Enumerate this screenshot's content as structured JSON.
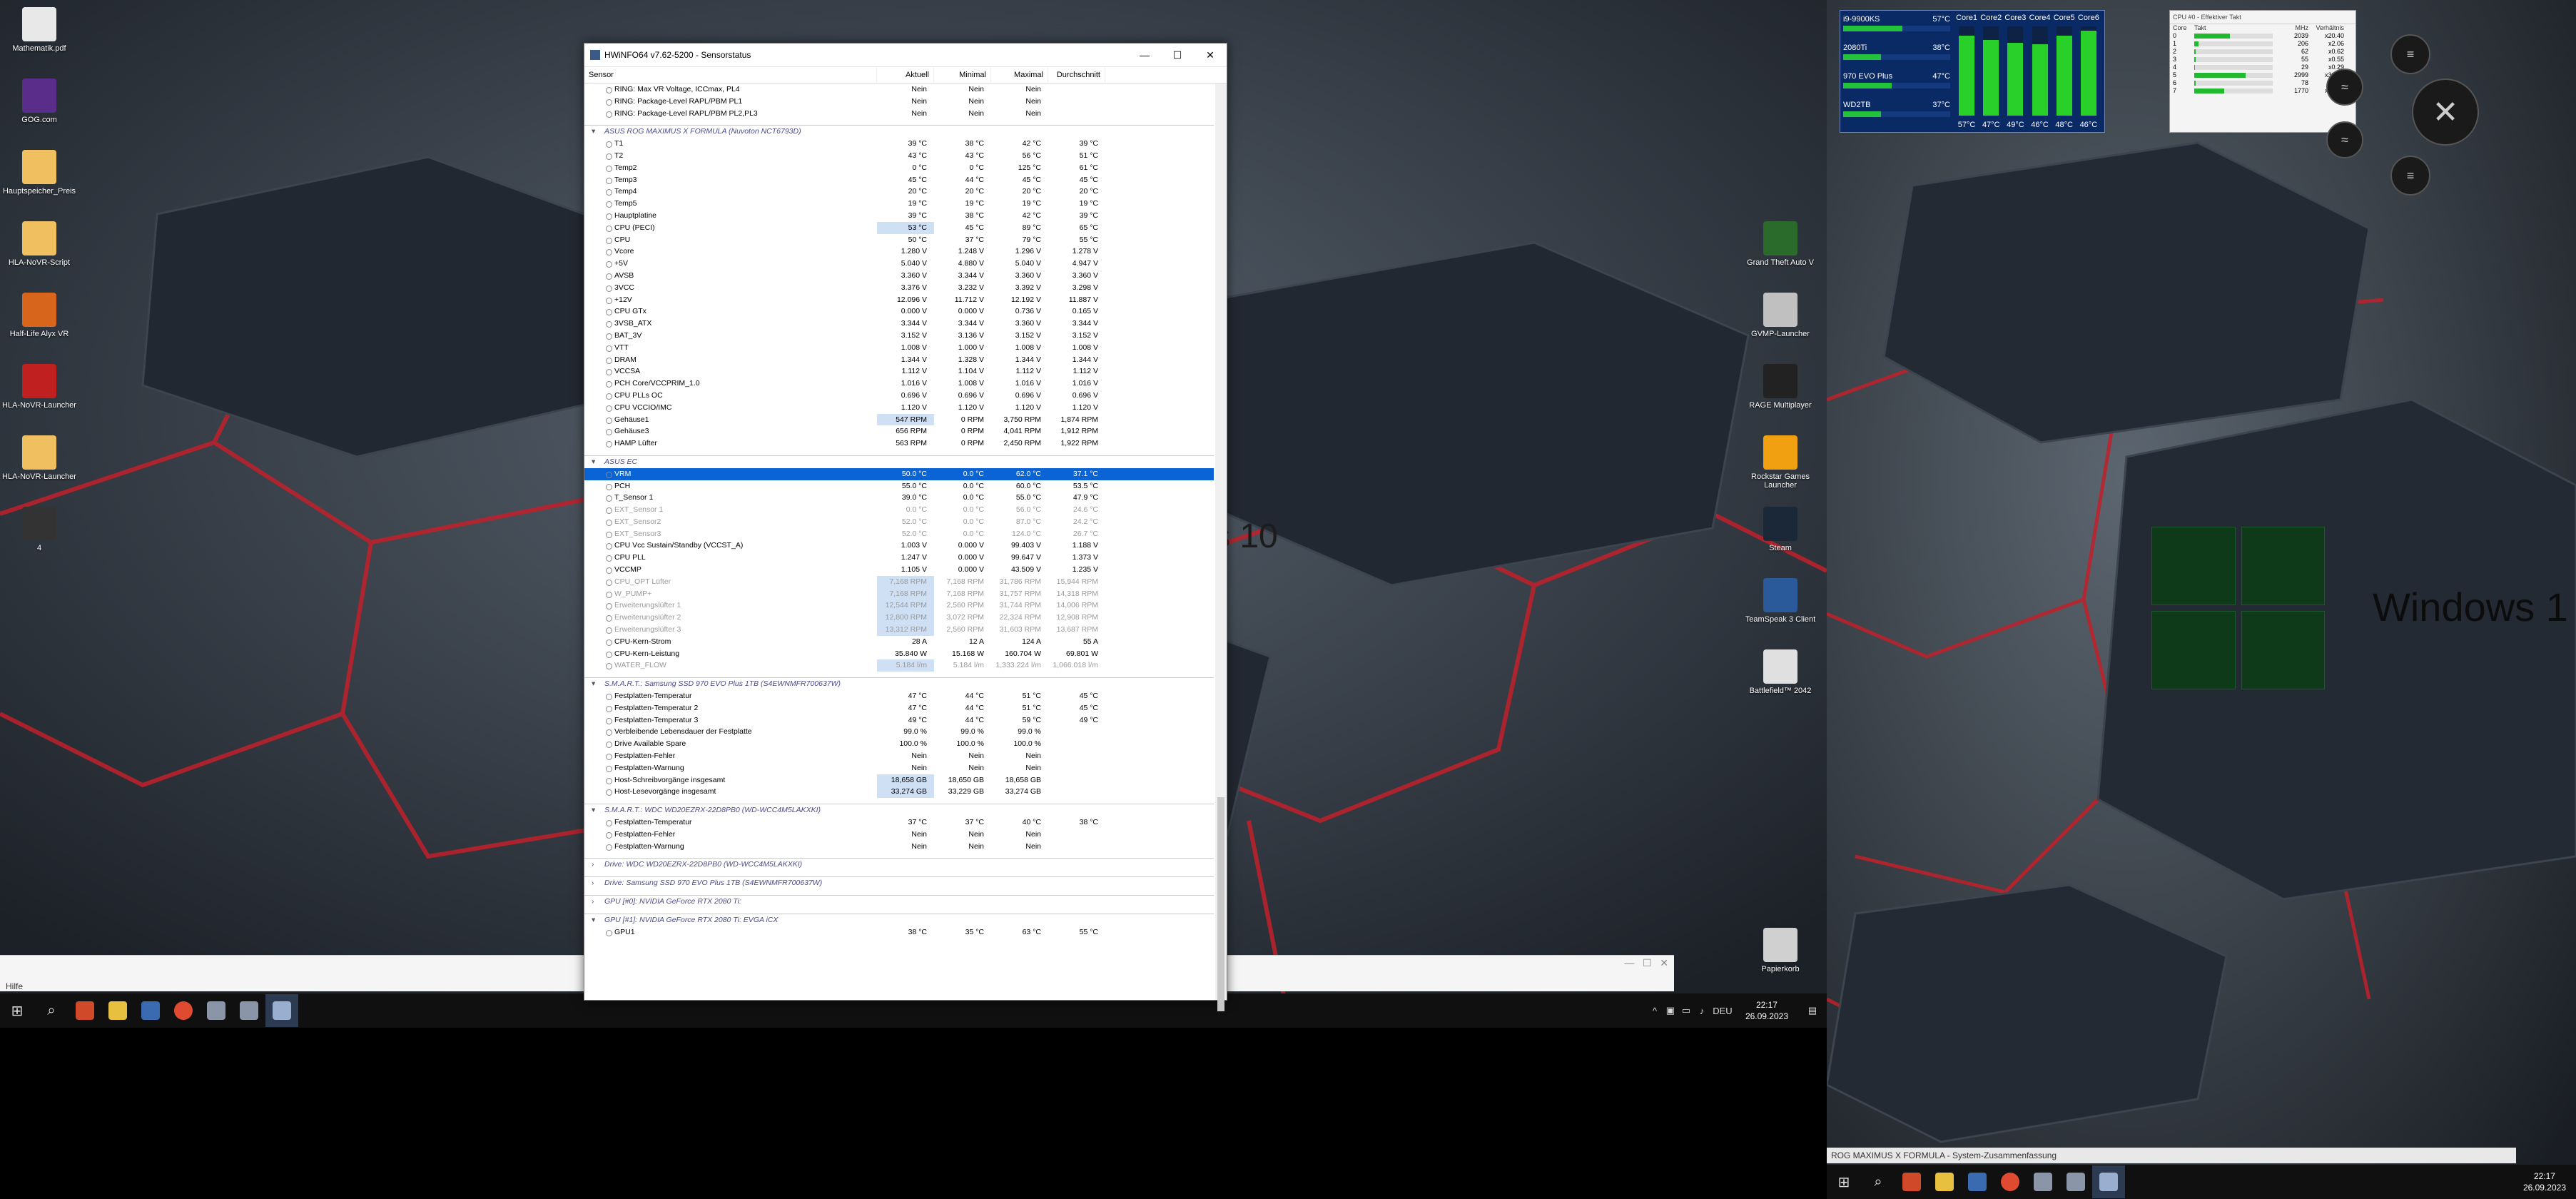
{
  "left_desktop": {
    "icons": [
      {
        "label": "Mathematik.pdf",
        "color": "#e8e8e8"
      },
      {
        "label": "GOG.com",
        "color": "#5b2d8a"
      },
      {
        "label": "Hauptspeicher_Preis",
        "color": "#f0c060"
      },
      {
        "label": "HLA-NoVR-Script",
        "color": "#f0c060"
      },
      {
        "label": "Half-Life Alyx VR",
        "color": "#d8651c"
      },
      {
        "label": "HLA-NoVR-Launcher",
        "color": "#c02020"
      },
      {
        "label": "HLA-NoVR-Launcher",
        "color": "#f0c060"
      },
      {
        "label": "4",
        "color": "#333"
      }
    ],
    "right_icons": [
      {
        "label": "Grand Theft Auto V",
        "color": "#2a6a2a"
      },
      {
        "label": "GVMP-Launcher",
        "color": "#c0c0c0"
      },
      {
        "label": "RAGE Multiplayer",
        "color": "#222"
      },
      {
        "label": "Rockstar Games Launcher",
        "color": "#f0a010"
      },
      {
        "label": "Steam",
        "color": "#1b2838"
      },
      {
        "label": "TeamSpeak 3 Client",
        "color": "#2a5a9a"
      },
      {
        "label": "Battlefield™ 2042",
        "color": "#e0e0e0"
      },
      {
        "label": "Papierkorb",
        "color": "#d0d0d0"
      }
    ],
    "wallpaper_text": "s 10"
  },
  "behind_window": {
    "menu": "Hilfe"
  },
  "hwinfo": {
    "title": "HWiNFO64 v7.62-5200 - Sensorstatus",
    "columns": [
      "Sensor",
      "Aktuell",
      "Minimal",
      "Maximal",
      "Durchschnitt"
    ],
    "rows": [
      {
        "t": "r",
        "n": "RING: Max VR Voltage, ICCmax, PL4",
        "a": "Nein",
        "mi": "Nein",
        "ma": "Nein",
        "d": ""
      },
      {
        "t": "r",
        "n": "RING: Package-Level RAPL/PBM PL1",
        "a": "Nein",
        "mi": "Nein",
        "ma": "Nein",
        "d": ""
      },
      {
        "t": "r",
        "n": "RING: Package-Level RAPL/PBM PL2,PL3",
        "a": "Nein",
        "mi": "Nein",
        "ma": "Nein",
        "d": ""
      },
      {
        "t": "s"
      },
      {
        "t": "g",
        "n": "ASUS ROG MAXIMUS X FORMULA (Nuvoton NCT6793D)"
      },
      {
        "t": "r",
        "n": "T1",
        "a": "39 °C",
        "mi": "38 °C",
        "ma": "42 °C",
        "d": "39 °C"
      },
      {
        "t": "r",
        "n": "T2",
        "a": "43 °C",
        "mi": "43 °C",
        "ma": "56 °C",
        "d": "51 °C"
      },
      {
        "t": "r",
        "n": "Temp2",
        "a": "0 °C",
        "mi": "0 °C",
        "ma": "125 °C",
        "d": "61 °C"
      },
      {
        "t": "r",
        "n": "Temp3",
        "a": "45 °C",
        "mi": "44 °C",
        "ma": "45 °C",
        "d": "45 °C"
      },
      {
        "t": "r",
        "n": "Temp4",
        "a": "20 °C",
        "mi": "20 °C",
        "ma": "20 °C",
        "d": "20 °C"
      },
      {
        "t": "r",
        "n": "Temp5",
        "a": "19 °C",
        "mi": "19 °C",
        "ma": "19 °C",
        "d": "19 °C"
      },
      {
        "t": "r",
        "n": "Hauptplatine",
        "a": "39 °C",
        "mi": "38 °C",
        "ma": "42 °C",
        "d": "39 °C"
      },
      {
        "t": "r",
        "h": 1,
        "n": "CPU (PECI)",
        "a": "53 °C",
        "mi": "45 °C",
        "ma": "89 °C",
        "d": "65 °C"
      },
      {
        "t": "r",
        "n": "CPU",
        "a": "50 °C",
        "mi": "37 °C",
        "ma": "79 °C",
        "d": "55 °C"
      },
      {
        "t": "r",
        "n": "Vcore",
        "a": "1.280 V",
        "mi": "1.248 V",
        "ma": "1.296 V",
        "d": "1.278 V"
      },
      {
        "t": "r",
        "n": "+5V",
        "a": "5.040 V",
        "mi": "4.880 V",
        "ma": "5.040 V",
        "d": "4.947 V"
      },
      {
        "t": "r",
        "n": "AVSB",
        "a": "3.360 V",
        "mi": "3.344 V",
        "ma": "3.360 V",
        "d": "3.360 V"
      },
      {
        "t": "r",
        "n": "3VCC",
        "a": "3.376 V",
        "mi": "3.232 V",
        "ma": "3.392 V",
        "d": "3.298 V"
      },
      {
        "t": "r",
        "n": "+12V",
        "a": "12.096 V",
        "mi": "11.712 V",
        "ma": "12.192 V",
        "d": "11.887 V"
      },
      {
        "t": "r",
        "n": "CPU GTx",
        "a": "0.000 V",
        "mi": "0.000 V",
        "ma": "0.736 V",
        "d": "0.165 V"
      },
      {
        "t": "r",
        "n": "3VSB_ATX",
        "a": "3.344 V",
        "mi": "3.344 V",
        "ma": "3.360 V",
        "d": "3.344 V"
      },
      {
        "t": "r",
        "n": "BAT_3V",
        "a": "3.152 V",
        "mi": "3.136 V",
        "ma": "3.152 V",
        "d": "3.152 V"
      },
      {
        "t": "r",
        "n": "VTT",
        "a": "1.008 V",
        "mi": "1.000 V",
        "ma": "1.008 V",
        "d": "1.008 V"
      },
      {
        "t": "r",
        "n": "DRAM",
        "a": "1.344 V",
        "mi": "1.328 V",
        "ma": "1.344 V",
        "d": "1.344 V"
      },
      {
        "t": "r",
        "n": "VCCSA",
        "a": "1.112 V",
        "mi": "1.104 V",
        "ma": "1.112 V",
        "d": "1.112 V"
      },
      {
        "t": "r",
        "n": "PCH Core/VCCPRIM_1.0",
        "a": "1.016 V",
        "mi": "1.008 V",
        "ma": "1.016 V",
        "d": "1.016 V"
      },
      {
        "t": "r",
        "n": "CPU PLLs OC",
        "a": "0.696 V",
        "mi": "0.696 V",
        "ma": "0.696 V",
        "d": "0.696 V"
      },
      {
        "t": "r",
        "n": "CPU VCCIO/IMC",
        "a": "1.120 V",
        "mi": "1.120 V",
        "ma": "1.120 V",
        "d": "1.120 V"
      },
      {
        "t": "r",
        "h": 1,
        "n": "Gehäuse1",
        "a": "547 RPM",
        "mi": "0 RPM",
        "ma": "3,750 RPM",
        "d": "1,874 RPM"
      },
      {
        "t": "r",
        "n": "Gehäuse3",
        "a": "656 RPM",
        "mi": "0 RPM",
        "ma": "4,041 RPM",
        "d": "1,912 RPM"
      },
      {
        "t": "r",
        "n": "HAMP Lüfter",
        "a": "563 RPM",
        "mi": "0 RPM",
        "ma": "2,450 RPM",
        "d": "1,922 RPM"
      },
      {
        "t": "s"
      },
      {
        "t": "g",
        "n": "ASUS EC"
      },
      {
        "t": "r",
        "sel": 1,
        "n": "VRM",
        "a": "50.0 °C",
        "mi": "0.0 °C",
        "ma": "62.0 °C",
        "d": "37.1 °C"
      },
      {
        "t": "r",
        "n": "PCH",
        "a": "55.0 °C",
        "mi": "0.0 °C",
        "ma": "60.0 °C",
        "d": "53.5 °C"
      },
      {
        "t": "r",
        "n": "T_Sensor 1",
        "a": "39.0 °C",
        "mi": "0.0 °C",
        "ma": "55.0 °C",
        "d": "47.9 °C"
      },
      {
        "t": "r",
        "dim": 1,
        "n": "EXT_Sensor 1",
        "a": "0.0 °C",
        "mi": "0.0 °C",
        "ma": "56.0 °C",
        "d": "24.6 °C"
      },
      {
        "t": "r",
        "dim": 1,
        "n": "EXT_Sensor2",
        "a": "52.0 °C",
        "mi": "0.0 °C",
        "ma": "87.0 °C",
        "d": "24.2 °C"
      },
      {
        "t": "r",
        "dim": 1,
        "n": "EXT_Sensor3",
        "a": "52.0 °C",
        "mi": "0.0 °C",
        "ma": "124.0 °C",
        "d": "26.7 °C"
      },
      {
        "t": "r",
        "n": "CPU Vcc Sustain/Standby (VCCST_A)",
        "a": "1.003 V",
        "mi": "0.000 V",
        "ma": "99.403 V",
        "d": "1.188 V"
      },
      {
        "t": "r",
        "n": "CPU PLL",
        "a": "1.247 V",
        "mi": "0.000 V",
        "ma": "99.647 V",
        "d": "1.373 V"
      },
      {
        "t": "r",
        "n": "VCCMP",
        "a": "1.105 V",
        "mi": "0.000 V",
        "ma": "43.509 V",
        "d": "1.235 V"
      },
      {
        "t": "r",
        "dim": 1,
        "h": 1,
        "n": "CPU_OPT Lüfter",
        "a": "7,168 RPM",
        "mi": "7,168 RPM",
        "ma": "31,786 RPM",
        "d": "15,944 RPM"
      },
      {
        "t": "r",
        "dim": 1,
        "h": 1,
        "n": "W_PUMP+",
        "a": "7,168 RPM",
        "mi": "7,168 RPM",
        "ma": "31,757 RPM",
        "d": "14,318 RPM"
      },
      {
        "t": "r",
        "dim": 1,
        "h": 1,
        "n": "Erweiterungslüfter 1",
        "a": "12,544 RPM",
        "mi": "2,560 RPM",
        "ma": "31,744 RPM",
        "d": "14,006 RPM"
      },
      {
        "t": "r",
        "dim": 1,
        "h": 1,
        "n": "Erweiterungslüfter 2",
        "a": "12,800 RPM",
        "mi": "3,072 RPM",
        "ma": "22,324 RPM",
        "d": "12,908 RPM"
      },
      {
        "t": "r",
        "dim": 1,
        "h": 1,
        "n": "Erweiterungslüfter 3",
        "a": "13,312 RPM",
        "mi": "2,560 RPM",
        "ma": "31,603 RPM",
        "d": "13,687 RPM"
      },
      {
        "t": "r",
        "n": "CPU-Kern-Strom",
        "a": "28 A",
        "mi": "12 A",
        "ma": "124 A",
        "d": "55 A"
      },
      {
        "t": "r",
        "n": "CPU-Kern-Leistung",
        "a": "35.840 W",
        "mi": "15.168 W",
        "ma": "160.704 W",
        "d": "69.801 W"
      },
      {
        "t": "r",
        "dim": 1,
        "h": 1,
        "n": "WATER_FLOW",
        "a": "5.184 l/m",
        "mi": "5.184 l/m",
        "ma": "1,333.224 l/m",
        "d": "1,066.018 l/m"
      },
      {
        "t": "s"
      },
      {
        "t": "g",
        "n": "S.M.A.R.T.: Samsung SSD 970 EVO Plus 1TB (S4EWNMFR700637W)"
      },
      {
        "t": "r",
        "n": "Festplatten-Temperatur",
        "a": "47 °C",
        "mi": "44 °C",
        "ma": "51 °C",
        "d": "45 °C"
      },
      {
        "t": "r",
        "n": "Festplatten-Temperatur 2",
        "a": "47 °C",
        "mi": "44 °C",
        "ma": "51 °C",
        "d": "45 °C"
      },
      {
        "t": "r",
        "n": "Festplatten-Temperatur 3",
        "a": "49 °C",
        "mi": "44 °C",
        "ma": "59 °C",
        "d": "49 °C"
      },
      {
        "t": "r",
        "n": "Verbleibende Lebensdauer der Festplatte",
        "a": "99.0 %",
        "mi": "99.0 %",
        "ma": "99.0 %",
        "d": ""
      },
      {
        "t": "r",
        "n": "Drive Available Spare",
        "a": "100.0 %",
        "mi": "100.0 %",
        "ma": "100.0 %",
        "d": ""
      },
      {
        "t": "r",
        "n": "Festplatten-Fehler",
        "a": "Nein",
        "mi": "Nein",
        "ma": "Nein",
        "d": ""
      },
      {
        "t": "r",
        "n": "Festplatten-Warnung",
        "a": "Nein",
        "mi": "Nein",
        "ma": "Nein",
        "d": ""
      },
      {
        "t": "r",
        "h": 1,
        "n": "Host-Schreibvorgänge insgesamt",
        "a": "18,658 GB",
        "mi": "18,650 GB",
        "ma": "18,658 GB",
        "d": ""
      },
      {
        "t": "r",
        "h": 1,
        "n": "Host-Lesevorgänge insgesamt",
        "a": "33,274 GB",
        "mi": "33,229 GB",
        "ma": "33,274 GB",
        "d": ""
      },
      {
        "t": "s"
      },
      {
        "t": "g",
        "n": "S.M.A.R.T.: WDC WD20EZRX-22D8PB0 (WD-WCC4M5LAKXKI)"
      },
      {
        "t": "r",
        "n": "Festplatten-Temperatur",
        "a": "37 °C",
        "mi": "37 °C",
        "ma": "40 °C",
        "d": "38 °C"
      },
      {
        "t": "r",
        "n": "Festplatten-Fehler",
        "a": "Nein",
        "mi": "Nein",
        "ma": "Nein",
        "d": ""
      },
      {
        "t": "r",
        "n": "Festplatten-Warnung",
        "a": "Nein",
        "mi": "Nein",
        "ma": "Nein",
        "d": ""
      },
      {
        "t": "s"
      },
      {
        "t": "g",
        "c": 1,
        "n": "Drive: WDC WD20EZRX-22D8PB0 (WD-WCC4M5LAKXKI)"
      },
      {
        "t": "s"
      },
      {
        "t": "g",
        "c": 1,
        "n": "Drive: Samsung SSD 970 EVO Plus 1TB (S4EWNMFR700637W)"
      },
      {
        "t": "s"
      },
      {
        "t": "g",
        "c": 1,
        "n": "GPU [#0]: NVIDIA GeForce RTX 2080 Ti:"
      },
      {
        "t": "s"
      },
      {
        "t": "g",
        "n": "GPU [#1]: NVIDIA GeForce RTX 2080 Ti: EVGA iCX"
      },
      {
        "t": "r",
        "n": "GPU1",
        "a": "38 °C",
        "mi": "35 °C",
        "ma": "63 °C",
        "d": "55 °C"
      }
    ]
  },
  "left_taskbar": {
    "lang": "DEU",
    "time": "22:17",
    "date": "26.09.2023"
  },
  "right_taskbar": {
    "lang": "",
    "time": "22:17",
    "date": "26.09.2023"
  },
  "right_desktop": {
    "wallpaper_text": "Windows 1",
    "bottom_strip": "ROG MAXIMUS X FORMULA - System-Zusammenfassung",
    "gpu_widget": {
      "labels": [
        {
          "name": "i9-9900KS",
          "val": "57°C",
          "fill": 0.55
        },
        {
          "name": "2080Ti",
          "val": "38°C",
          "fill": 0.35
        },
        {
          "name": "970 EVO Plus",
          "val": "47°C",
          "fill": 0.45
        },
        {
          "name": "WD2TB",
          "val": "37°C",
          "fill": 0.35
        }
      ],
      "cores": [
        "Core1",
        "Core2",
        "Core3",
        "Core4",
        "Core5",
        "Core6"
      ],
      "core_fill": [
        0.9,
        0.85,
        0.82,
        0.8,
        0.9,
        0.95
      ],
      "core_temps": [
        "57°C",
        "47°C",
        "49°C",
        "46°C",
        "48°C",
        "46°C"
      ]
    },
    "cpu_widget": {
      "title": "CPU #0 - Effektiver Takt",
      "headers": [
        "Core",
        "Takt",
        "MHz",
        "Verhältnis"
      ],
      "rows": [
        {
          "c": "0",
          "mhz": "2039",
          "r": "x20.40",
          "fill": 0.45
        },
        {
          "c": "1",
          "mhz": "206",
          "r": "x2.06",
          "fill": 0.05
        },
        {
          "c": "2",
          "mhz": "62",
          "r": "x0.62",
          "fill": 0.02
        },
        {
          "c": "3",
          "mhz": "55",
          "r": "x0.55",
          "fill": 0.02
        },
        {
          "c": "4",
          "mhz": "29",
          "r": "x0.29",
          "fill": 0.01
        },
        {
          "c": "5",
          "mhz": "2999",
          "r": "x30.01",
          "fill": 0.65
        },
        {
          "c": "6",
          "mhz": "78",
          "r": "x0.78",
          "fill": 0.02
        },
        {
          "c": "7",
          "mhz": "1770",
          "r": "x17.71",
          "fill": 0.38
        }
      ]
    }
  }
}
